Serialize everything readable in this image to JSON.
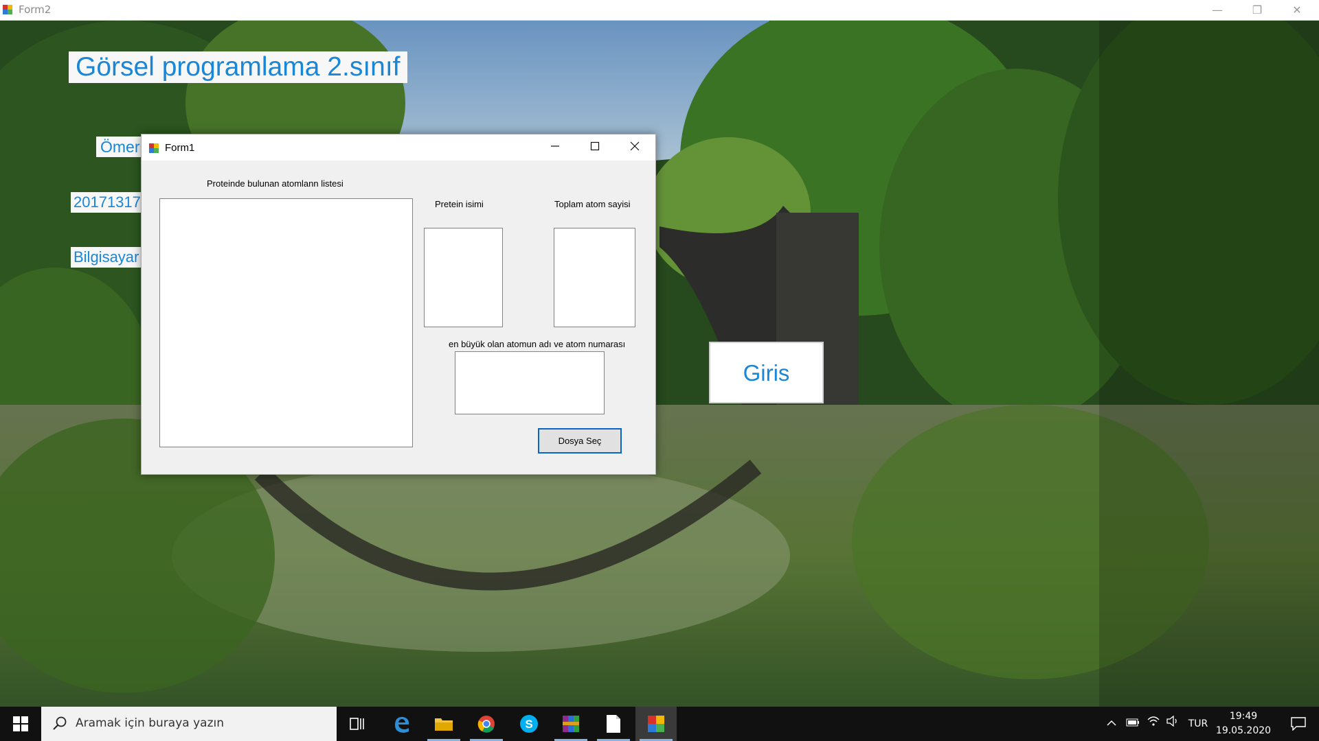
{
  "form2": {
    "title": "Form2",
    "minimize_glyph": "—",
    "restore_glyph": "❐",
    "close_glyph": "✕"
  },
  "labels": {
    "title": "Görsel programlama 2.sınıf",
    "name": "Ömer",
    "number": "20171317",
    "department": "Bilgisayar"
  },
  "giris_button": "Giris",
  "form1": {
    "title": "Form1",
    "atom_list_label": "Proteinde bulunan atomlann listesi",
    "protein_name_label": "Pretein isimi",
    "total_atoms_label": "Toplam atom sayisi",
    "largest_atom_label": "en büyük olan atomun adı ve atom numarası",
    "file_button": "Dosya Seç"
  },
  "taskbar": {
    "search_placeholder": "Aramak için buraya yazın",
    "language": "TUR",
    "time": "19:49",
    "date": "19.05.2020",
    "apps": [
      "task-view",
      "edge",
      "file-explorer",
      "chrome",
      "skype",
      "winrar",
      "notepad",
      "form-app"
    ],
    "active_app": "form-app"
  },
  "colors": {
    "label_blue": "#1a86d6",
    "button_focus_border": "#0a64c8",
    "taskbar": "#111111"
  }
}
